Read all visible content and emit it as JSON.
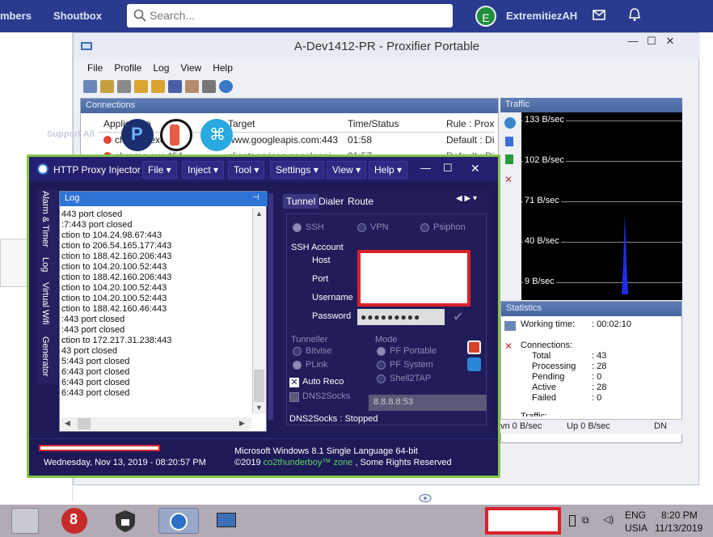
{
  "forum": {
    "nav_left": "mbers",
    "nav_shoutbox": "Shoutbox",
    "search_placeholder": "Search...",
    "avatar_letter": "E",
    "username": "ExtremitiezAH"
  },
  "proxifier": {
    "title": "A-Dev1412-PR - Proxifier Portable",
    "menu": [
      "File",
      "Profile",
      "Log",
      "View",
      "Help"
    ],
    "connections": {
      "pane_title": "Connections",
      "headers": [
        "Application",
        "Target",
        "Time/Status",
        "Rule : Proxy"
      ],
      "rows": [
        {
          "app": "chrome.exe",
          "target": "www.googleapis.com:443",
          "time": "01:58",
          "rule": "Default : Direct"
        },
        {
          "app": "chrome.exe *64",
          "target": "clientservices.googleapi...",
          "time": "01:57",
          "rule": "Default : Direct"
        }
      ],
      "watermark": "Support All"
    },
    "traffic": {
      "pane_title": "Traffic",
      "labels": [
        "133 B/sec",
        "102 B/sec",
        "71 B/sec",
        "40 B/sec",
        "9 B/sec"
      ]
    },
    "statistics": {
      "pane_title": "Statistics",
      "working_time_label": "Working time:",
      "working_time": ": 00:02:10",
      "connections_label": "Connections:",
      "rows": [
        {
          "k": "Total",
          "v": ": 43"
        },
        {
          "k": "Processing",
          "v": ": 28"
        },
        {
          "k": "Pending",
          "v": ": 0"
        },
        {
          "k": "Active",
          "v": ": 28"
        },
        {
          "k": "Failed",
          "v": ": 0"
        }
      ],
      "traffic_cut": "Traffic:"
    },
    "statusbar": {
      "down": "vn 0 B/sec",
      "up": "Up 0 B/sec",
      "dn": "DN"
    }
  },
  "hpi": {
    "title": "HTTP Proxy Injector",
    "menus": [
      "File",
      "Inject",
      "Tool",
      "Settings",
      "View",
      "Help"
    ],
    "sidetabs": [
      "Alarm & Timer",
      "Log",
      "Virtual Wifi",
      "Generator"
    ],
    "log_title": "Log",
    "log_lines": [
      "443 port closed",
      ":7:443 port closed",
      "ction to 104.24.98.67:443",
      "ction to 206.54.165.177:443",
      "ction to 188.42.160.206:443",
      "ction to 104.20.100.52:443",
      "ction to 188.42.160.206:443",
      "ction to 104.20.100.52:443",
      "ction to 104.20.100.52:443",
      "ction to 188.42.160.46:443",
      ":443 port closed",
      ":443 port closed",
      "ction to 172.217.31.238:443",
      "43 port closed",
      "5:443 port closed",
      "6:443 port closed",
      "6:443 port closed",
      "6:443 port closed"
    ],
    "tabs": [
      "Tunnel",
      "Dialer",
      "Route"
    ],
    "protocols": [
      "SSH",
      "VPN",
      "Psiphon"
    ],
    "ssh_account": "SSH Account",
    "fields": [
      "Host",
      "Port",
      "Username",
      "Password"
    ],
    "password_mask": "●●●●●●●●●",
    "tunneller_label": "Tunneller",
    "tunnellers": [
      "Bitvise",
      "PLink"
    ],
    "mode_label": "Mode",
    "modes": [
      "PF Portable",
      "PF System",
      "Shell2TAP"
    ],
    "auto_reco": "Auto Reco",
    "dns2socks": "DNS2Socks",
    "dns_value": "8.8.8.8:53",
    "dns_status": "DNS2Socks : Stopped",
    "datetime": "Wednesday, Nov 13, 2019 - 08:20:57 PM",
    "os_info": "Microsoft Windows 8.1 Single Language 64-bit",
    "copyright_pre": "©2019",
    "copyright_name": "co2thunderboy™ zone",
    "copyright_post": ", Some Rights Reserved"
  },
  "taskbar": {
    "lang1": "ENG",
    "lang2": "USIA",
    "time": "8:20 PM",
    "date": "11/13/2019"
  }
}
